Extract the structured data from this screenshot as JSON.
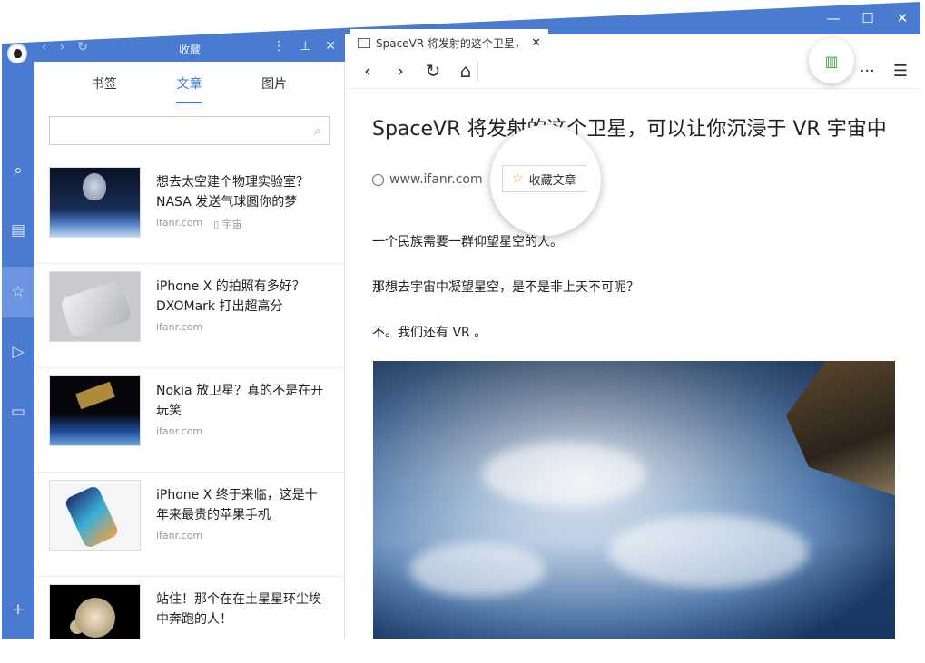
{
  "window": {
    "controls": [
      "—",
      "☐",
      "✕"
    ]
  },
  "rail": {
    "items": [
      {
        "icon": "search-icon",
        "glyph": "⌕"
      },
      {
        "icon": "news-icon",
        "glyph": "▤"
      },
      {
        "icon": "star-icon",
        "glyph": "☆"
      },
      {
        "icon": "play-icon",
        "glyph": "▷"
      },
      {
        "icon": "video-icon",
        "glyph": "▭"
      },
      {
        "icon": "plus-icon",
        "glyph": "+"
      }
    ]
  },
  "panel": {
    "title": "收藏",
    "nav_back": "‹",
    "nav_forward": "›",
    "nav_refresh": "↻",
    "tool_more": "⋮",
    "tool_pin": "⊥",
    "tool_close": "✕",
    "tabs": [
      "书签",
      "文章",
      "图片"
    ],
    "active_tab": 1,
    "search": {
      "value": "",
      "placeholder": ""
    },
    "items": [
      {
        "title": "想去太空建个物理实验室？NASA 发送气球圆你的梦",
        "source": "ifanr.com",
        "tag": "▯ 宇宙"
      },
      {
        "title": "iPhone X 的拍照有多好？DXOMark 打出超高分",
        "source": "ifanr.com",
        "tag": ""
      },
      {
        "title": "Nokia 放卫星？真的不是在开玩笑",
        "source": "ifanr.com",
        "tag": ""
      },
      {
        "title": "iPhone X 终于来临，这是十年来最贵的苹果手机",
        "source": "ifanr.com",
        "tag": ""
      },
      {
        "title": "站住！那个在在土星星环尘埃中奔跑的人！",
        "source": "",
        "tag": ""
      }
    ]
  },
  "browser": {
    "tab_title": "SpaceVR 将发射的这个卫星，...",
    "tab_close": "✕",
    "nav": {
      "back": "‹",
      "forward": "›",
      "refresh": "↻",
      "home": "⌂"
    },
    "more": "···",
    "menu": "☰",
    "reader_glyph": "▥"
  },
  "article": {
    "title": "SpaceVR 将发射的这个卫星，可以让你沉浸于 VR 宇宙中",
    "source": "www.ifanr.com",
    "fav_label": "收藏文章",
    "paragraphs": [
      "一个民族需要一群仰望星空的人。",
      "那想去宇宙中凝望星空，是不是非上天不可呢？",
      "不。我们还有 VR 。"
    ]
  },
  "colors": {
    "accent": "#4a7bd1",
    "tab_active": "#3a78d8",
    "reader_icon": "#3aa84a",
    "fav_star": "#f2a321"
  }
}
